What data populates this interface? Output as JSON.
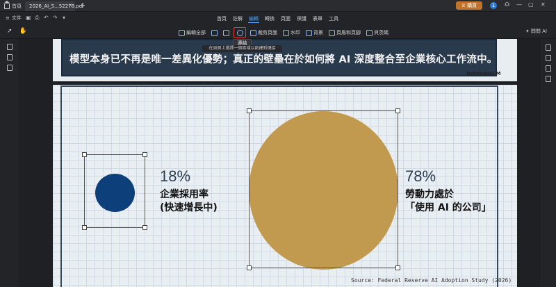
{
  "tabbar": {
    "home_label": "首頁",
    "doc_tab_title": "2026_AI_S...52278.pdf",
    "buy_label": "購買",
    "user_initial": "1"
  },
  "menubar": {
    "file_label": "文件",
    "items": [
      "首頁",
      "註解",
      "編輯",
      "轉換",
      "頁面",
      "保護",
      "表單",
      "工具"
    ],
    "active_index": 2
  },
  "toolbar": {
    "tools": [
      {
        "label": "編輯全部",
        "icon": "edit-all-icon"
      },
      {
        "label": "",
        "icon": "text-icon"
      },
      {
        "label": "",
        "icon": "image-icon"
      },
      {
        "label": "",
        "icon": "link-icon"
      },
      {
        "label": "裁剪頁面",
        "icon": "crop-icon"
      },
      {
        "label": "水印",
        "icon": "watermark-icon"
      },
      {
        "label": "背景",
        "icon": "background-icon"
      },
      {
        "label": "頁眉和頁腳",
        "icon": "header-footer-icon"
      },
      {
        "label": "貝茨碼",
        "icon": "bates-icon"
      }
    ],
    "ask_ai_label": "問問 AI"
  },
  "tooltip": {
    "title": "連結",
    "hint": "在頁面上選擇一個區域以創建新鏈接"
  },
  "slide1": {
    "text": "模型本身已不再是唯一差異化優勢；真正的壁壘在於如何將 AI 深度整合至企業核心工作流中。",
    "brand": "NotebookLM"
  },
  "slide2": {
    "stat_left_value": "18%",
    "stat_left_label_line1": "企業採用率",
    "stat_left_label_line2": "(快速增長中)",
    "stat_right_value": "78%",
    "stat_right_label_line1": "勞動力處於",
    "stat_right_label_line2": "「使用 AI 的公司」",
    "source": "Source: Federal Reserve AI Adoption Study (2026)"
  },
  "colors": {
    "accent": "#4aa3ff",
    "buy": "#c1732c",
    "small_circle": "#0d3f7a",
    "big_circle": "#c29a4f",
    "highlight": "#e0403c"
  }
}
